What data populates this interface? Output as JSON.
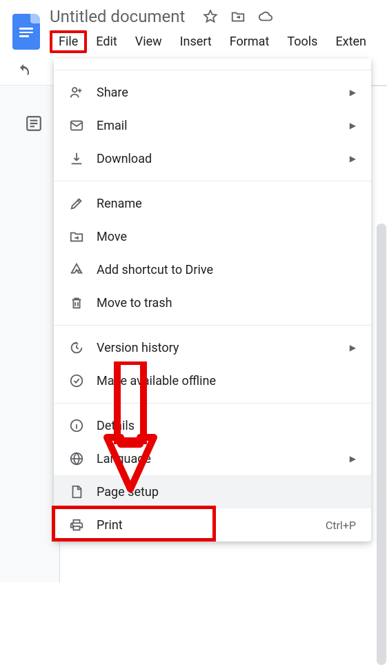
{
  "header": {
    "title": "Untitled document"
  },
  "menuBar": {
    "file": "File",
    "edit": "Edit",
    "view": "View",
    "insert": "Insert",
    "format": "Format",
    "tools": "Tools",
    "extensions": "Exten"
  },
  "fileMenu": {
    "share": "Share",
    "email": "Email",
    "download": "Download",
    "rename": "Rename",
    "move": "Move",
    "addShortcut": "Add shortcut to Drive",
    "moveToTrash": "Move to trash",
    "versionHistory": "Version history",
    "makeOffline": "Make available offline",
    "details": "Details",
    "language": "Language",
    "pageSetup": "Page setup",
    "print": "Print",
    "printShortcut": "Ctrl+P"
  }
}
